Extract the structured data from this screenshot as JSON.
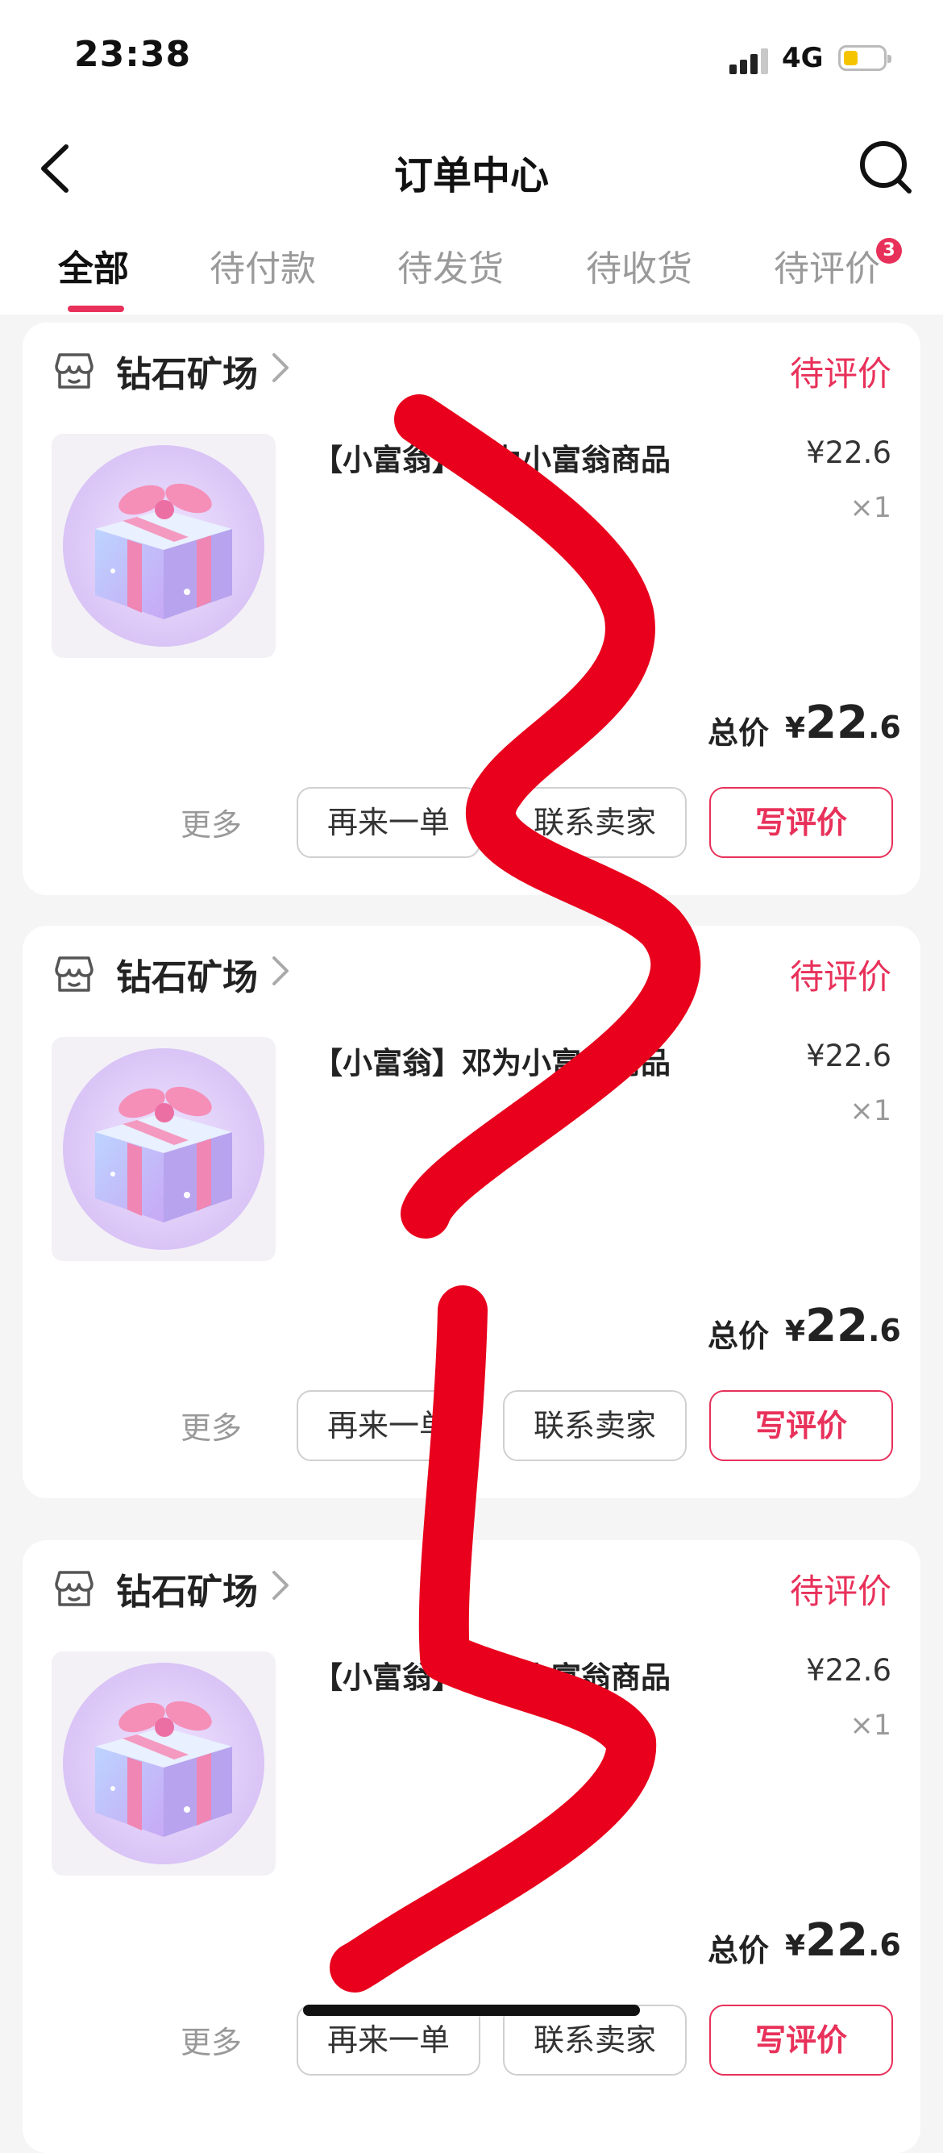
{
  "status_bar": {
    "time": "23:38",
    "network": "4G"
  },
  "header": {
    "title": "订单中心"
  },
  "tabs": [
    {
      "label": "全部",
      "active": true
    },
    {
      "label": "待付款"
    },
    {
      "label": "待发货"
    },
    {
      "label": "待收货"
    },
    {
      "label": "待评价",
      "badge": "3"
    }
  ],
  "orders": [
    {
      "store": "钻石矿场",
      "status": "待评价",
      "product_title": "【小富翁】邓为小富翁商品",
      "price": "¥22.6",
      "qty": "×1",
      "total_label": "总价",
      "total_currency": "¥",
      "total_int": "22",
      "total_dec": ".6",
      "more": "更多",
      "reorder": "再来一单",
      "contact": "联系卖家",
      "review": "写评价"
    },
    {
      "store": "钻石矿场",
      "status": "待评价",
      "product_title": "【小富翁】邓为小富翁商品",
      "price": "¥22.6",
      "qty": "×1",
      "total_label": "总价",
      "total_currency": "¥",
      "total_int": "22",
      "total_dec": ".6",
      "more": "更多",
      "reorder": "再来一单",
      "contact": "联系卖家",
      "review": "写评价"
    },
    {
      "store": "钻石矿场",
      "status": "待评价",
      "product_title": "【小富翁】邓为小富翁商品",
      "price": "¥22.6",
      "qty": "×1",
      "total_label": "总价",
      "total_currency": "¥",
      "total_int": "22",
      "total_dec": ".6",
      "more": "更多",
      "reorder": "再来一单",
      "contact": "联系卖家",
      "review": "写评价"
    }
  ],
  "colors": {
    "accent": "#e8315a",
    "scribble": "#e8001c",
    "background": "#f5f5f5"
  },
  "icons": [
    "back-arrow-icon",
    "search-icon",
    "store-icon",
    "chevron-right-icon",
    "gift-box-icon",
    "signal-icon",
    "battery-icon"
  ]
}
